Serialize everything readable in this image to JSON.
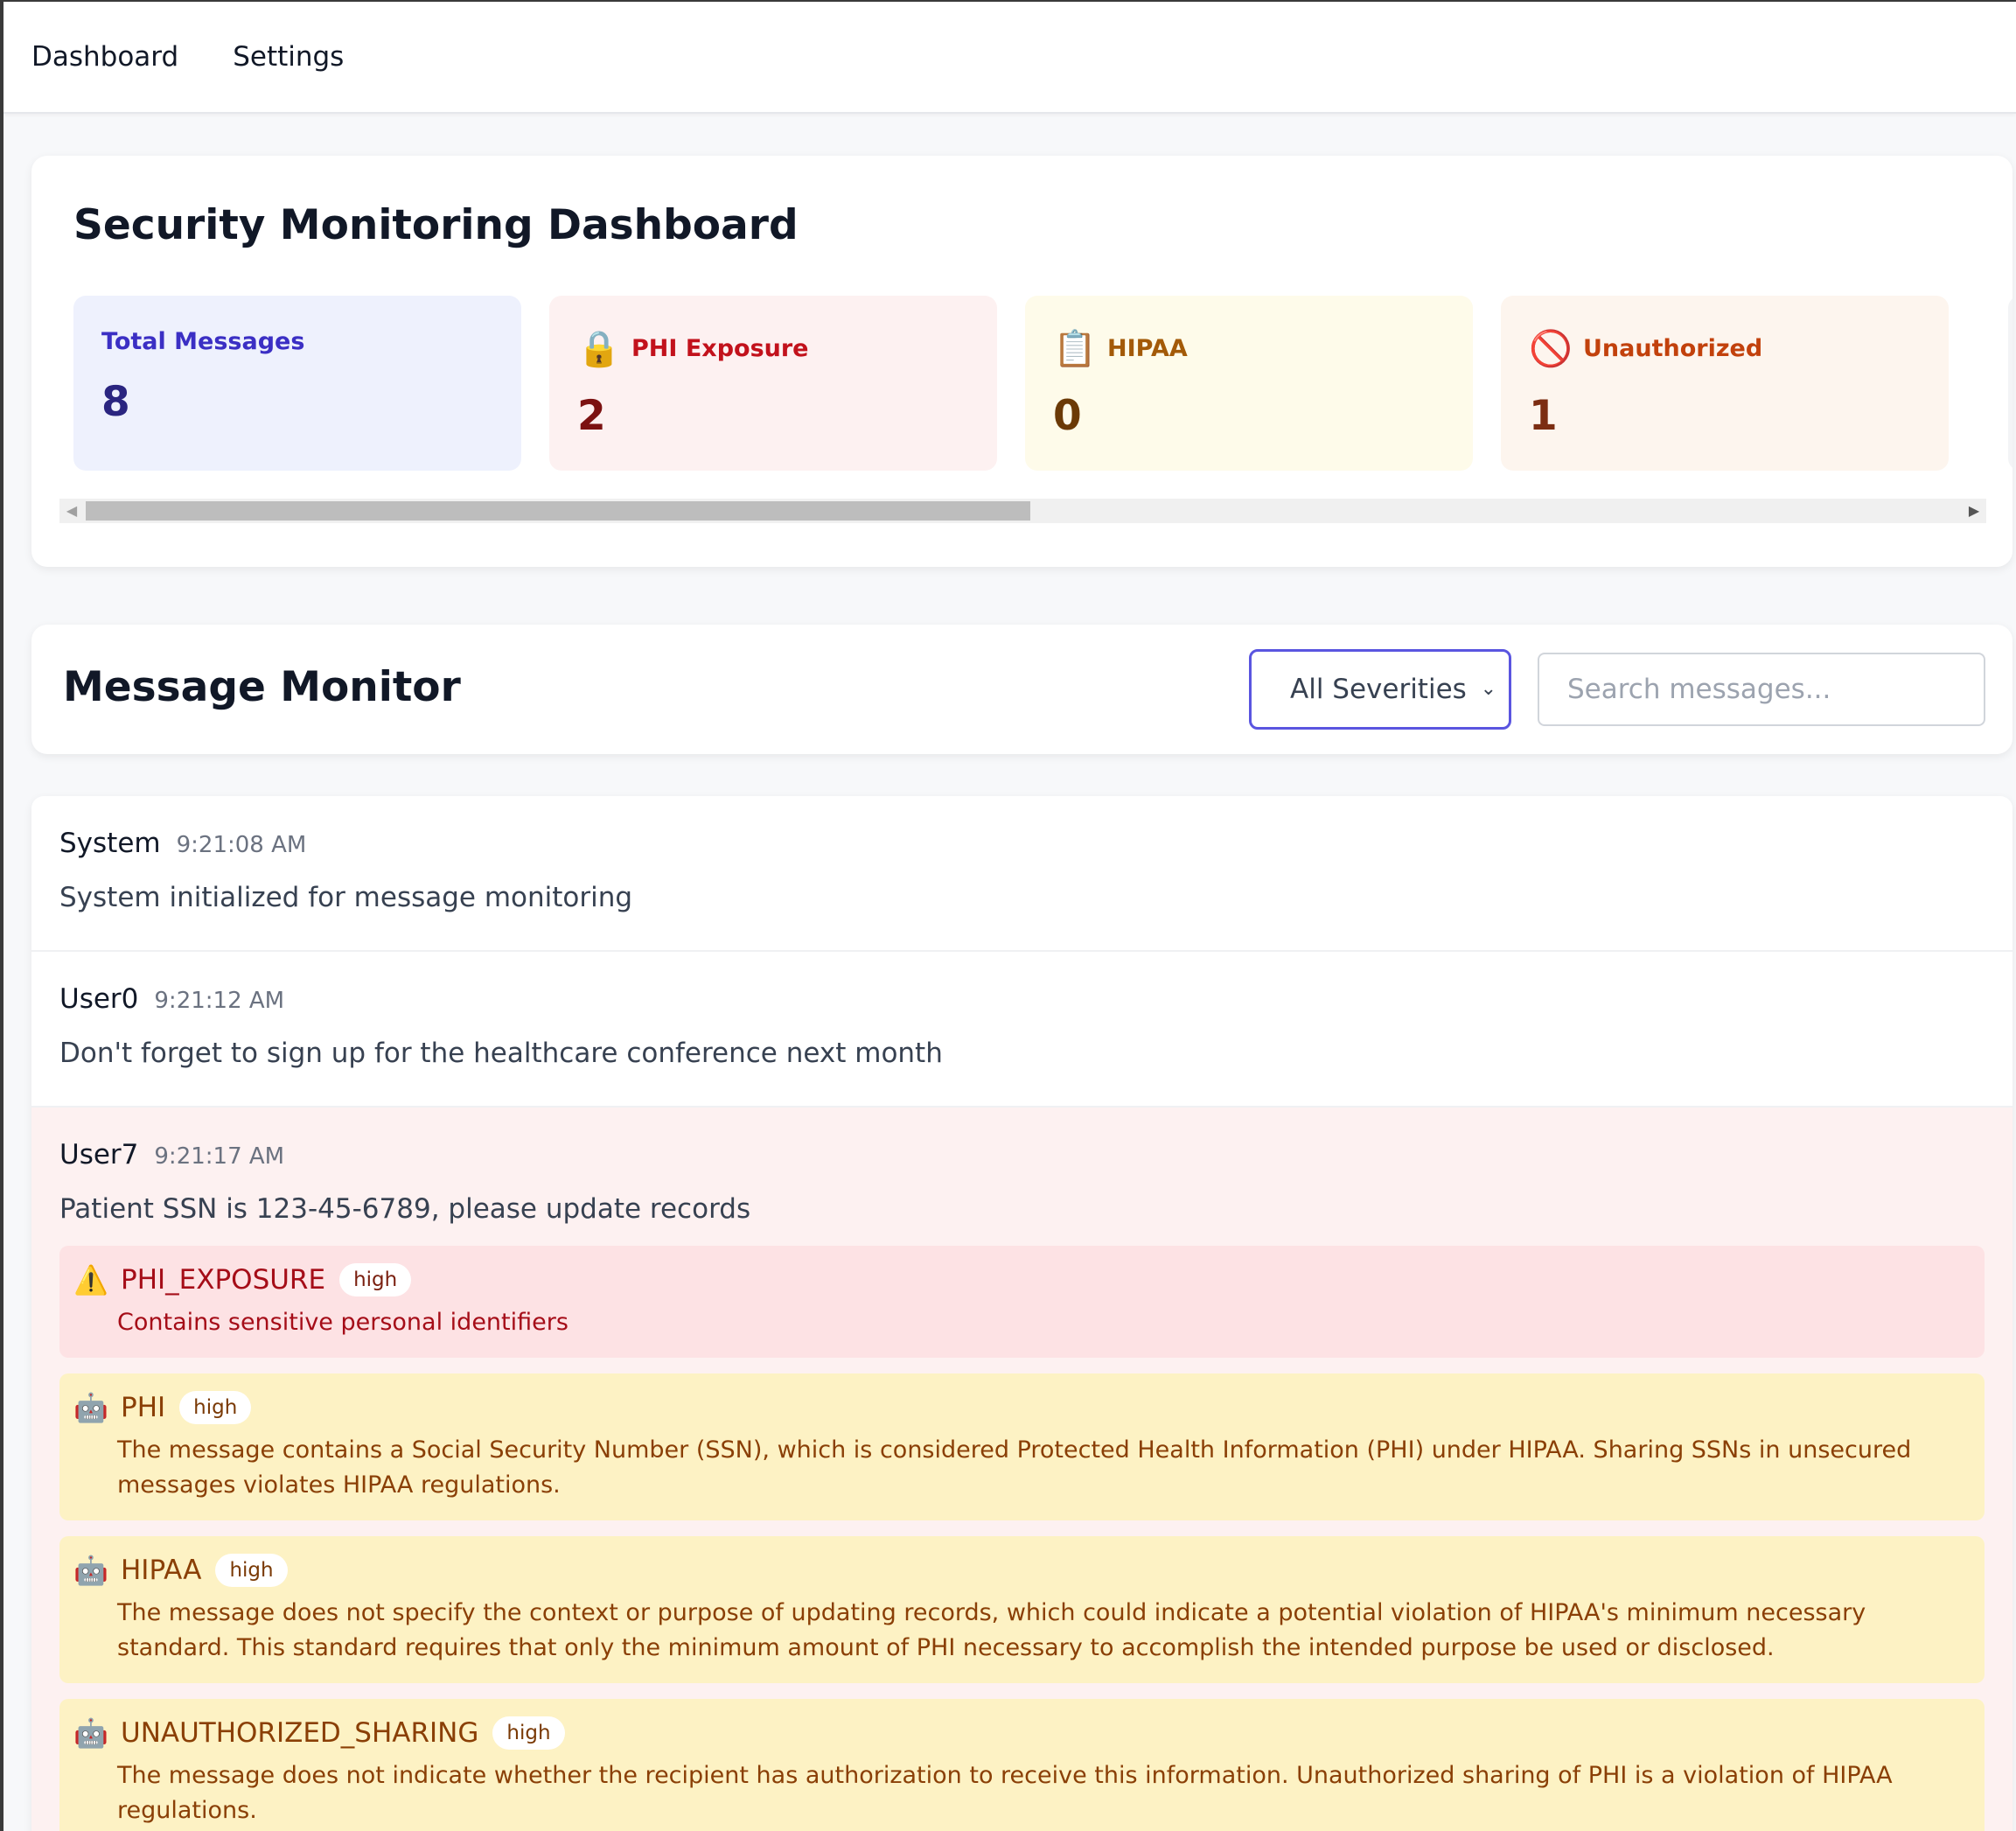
{
  "nav": {
    "links": [
      "Dashboard",
      "Settings"
    ]
  },
  "dashboard": {
    "title": "Security Monitoring Dashboard",
    "stats": [
      {
        "label": "Total Messages",
        "value": "8",
        "icon": "",
        "color": "#3b2fc4"
      },
      {
        "label": "PHI Exposure",
        "value": "2",
        "icon": "🔒",
        "icon_name": "lock-icon",
        "color": "#c2121c"
      },
      {
        "label": "HIPAA",
        "value": "0",
        "icon": "📋",
        "icon_name": "clipboard-icon",
        "color": "#a35a08"
      },
      {
        "label": "Unauthorized",
        "value": "1",
        "icon": "🚫",
        "icon_name": "prohibited-icon",
        "color": "#c2410c"
      }
    ],
    "scroll": {
      "left_arrow": "◀",
      "right_arrow": "▶"
    }
  },
  "monitor": {
    "title": "Message Monitor",
    "severity_filter": {
      "selected": "All Severities",
      "chevron": "⌄"
    },
    "search": {
      "placeholder": "Search messages..."
    }
  },
  "messages": [
    {
      "user": "System",
      "time": "9:21:08 AM",
      "text": "System initialized for message monitoring",
      "flags": []
    },
    {
      "user": "User0",
      "time": "9:21:12 AM",
      "text": "Don't forget to sign up for the healthcare conference next month",
      "flags": []
    },
    {
      "user": "User7",
      "time": "9:21:17 AM",
      "text": "Patient SSN is 123-45-6789, please update records",
      "flags": [
        {
          "icon": "⚠️",
          "icon_name": "warning-icon",
          "type": "PHI_EXPOSURE",
          "severity": "high",
          "description": "Contains sensitive personal identifiers",
          "tone": "red"
        },
        {
          "icon": "🤖",
          "icon_name": "robot-icon",
          "type": "PHI",
          "severity": "high",
          "description": "The message contains a Social Security Number (SSN), which is considered Protected Health Information (PHI) under HIPAA. Sharing SSNs in unsecured messages violates HIPAA regulations.",
          "tone": "amber"
        },
        {
          "icon": "🤖",
          "icon_name": "robot-icon",
          "type": "HIPAA",
          "severity": "high",
          "description": "The message does not specify the context or purpose of updating records, which could indicate a potential violation of HIPAA's minimum necessary standard. This standard requires that only the minimum amount of PHI necessary to accomplish the intended purpose be used or disclosed.",
          "tone": "amber"
        },
        {
          "icon": "🤖",
          "icon_name": "robot-icon",
          "type": "UNAUTHORIZED_SHARING",
          "severity": "high",
          "description": "The message does not indicate whether the recipient has authorization to receive this information. Unauthorized sharing of PHI is a violation of HIPAA regulations.",
          "tone": "amber"
        }
      ]
    }
  ],
  "colors": {
    "accent": "#5a55e0",
    "phi_bg": "#fdf1f1",
    "flag_red_bg": "#fde2e4",
    "flag_amber_bg": "#fdf2c4"
  }
}
